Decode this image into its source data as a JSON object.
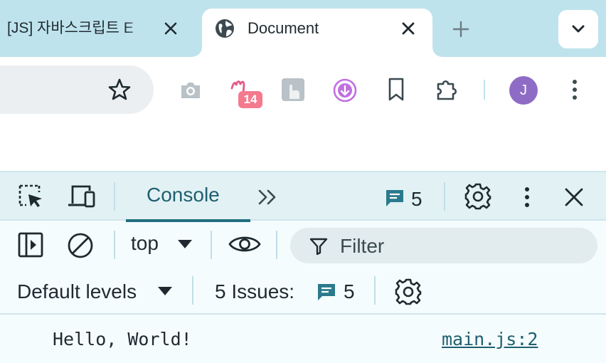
{
  "tabs": [
    {
      "title": "[JS] 자바스크립트 E",
      "active": false
    },
    {
      "title": "Document",
      "active": true
    }
  ],
  "toolbar": {
    "extension_badge": "14",
    "avatar_letter": "J"
  },
  "devtools": {
    "tabs": {
      "console": "Console"
    },
    "message_count": "5",
    "context": "top",
    "filter_placeholder": "Filter",
    "levels": "Default levels",
    "issues_label": "5 Issues:",
    "issues_count": "5",
    "console_log": [
      {
        "text": "Hello, World!",
        "source": "main.js:2"
      }
    ]
  },
  "colors": {
    "tabstrip_bg": "#bfe3ec",
    "accent": "#1f6f7f",
    "avatar": "#8e6cc6",
    "badge": "#f47a8e"
  },
  "icons": [
    "close-icon",
    "globe-icon",
    "plus-icon",
    "chevron-down-icon",
    "star-icon",
    "camera-icon",
    "extension-m-icon",
    "extension-hand-icon",
    "download-icon",
    "bookmark-icon",
    "puzzle-icon",
    "kebab-menu-icon",
    "inspect-element-icon",
    "device-toolbar-icon",
    "chevron-double-right-icon",
    "message-icon",
    "gear-icon",
    "sidebar-icon",
    "clear-icon",
    "caret-down-icon",
    "eye-icon",
    "filter-icon"
  ]
}
